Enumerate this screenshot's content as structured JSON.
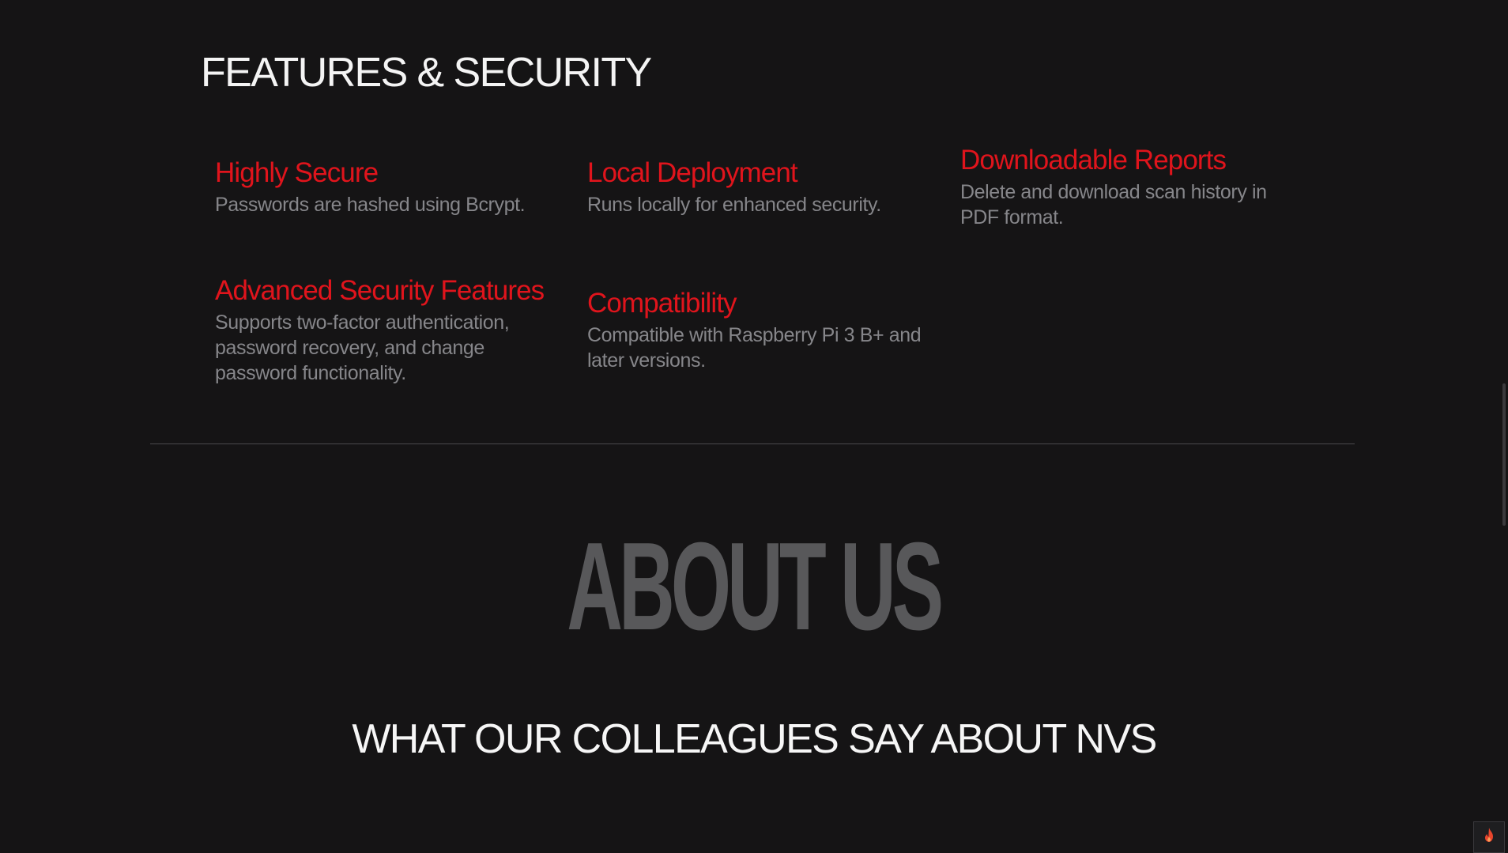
{
  "features": {
    "title": "FEATURES & SECURITY",
    "items": [
      {
        "title": "Highly Secure",
        "desc": "Passwords are hashed using Bcrypt."
      },
      {
        "title": "Local Deployment",
        "desc": "Runs locally for enhanced security."
      },
      {
        "title": "Downloadable Reports",
        "desc": "Delete and download scan history in PDF format."
      },
      {
        "title": "Advanced Security Features",
        "desc": "Supports two-factor authentication, password recovery, and change password functionality."
      },
      {
        "title": "Compatibility",
        "desc": "Compatible with Raspberry Pi 3 B+ and later versions."
      }
    ]
  },
  "about": {
    "title": "ABOUT US"
  },
  "testimonials": {
    "title": "WHAT OUR COLLEAGUES SAY ABOUT NVS"
  },
  "widget": {
    "icon": "flame-icon",
    "color": "#e8452c"
  },
  "colors": {
    "background": "#151415",
    "accent": "#e0141c",
    "muted_text": "#86868a",
    "about_text": "#58585a"
  }
}
